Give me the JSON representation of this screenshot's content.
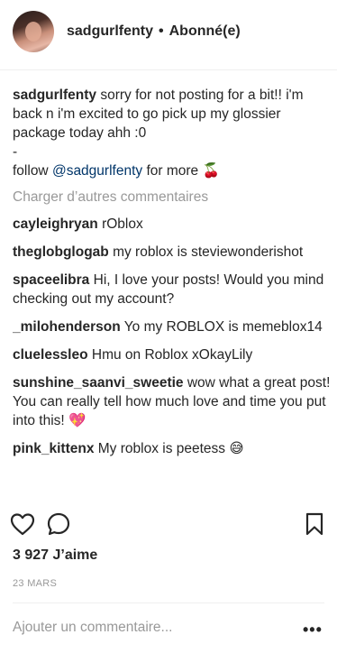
{
  "header": {
    "username": "sadgurlfenty",
    "separator": "•",
    "follow_status": "Abonné(e)"
  },
  "caption": {
    "username": "sadgurlfenty",
    "text": "sorry for not posting for a bit!! i'm back n i'm excited to go pick up my glossier package today ahh :0",
    "dash": "-",
    "follow_prefix": "follow",
    "mention": "@sadgurlfenty",
    "follow_suffix": "for more",
    "emoji": "🍒"
  },
  "load_more": "Charger d’autres commentaires",
  "comments": [
    {
      "username": "cayleighryan",
      "text": "rOblox"
    },
    {
      "username": "theglobglogab",
      "text": "my roblox is steviewonderishot"
    },
    {
      "username": "spaceelibra",
      "text": "Hi, I love your posts! Would you mind checking out my account?"
    },
    {
      "username": "_milohenderson",
      "text": "Yo my ROBLOX is memeblox14"
    },
    {
      "username": "cluelessleo",
      "text": "Hmu on Roblox xOkayLily"
    },
    {
      "username": "sunshine_saanvi_sweetie",
      "text": "wow what a great post! You can really tell how much love and time you put into this! 💖"
    },
    {
      "username": "pink_kittenx",
      "text": "My roblox is peetess 😅"
    }
  ],
  "icons": {
    "like": "heart-icon",
    "comment": "comment-bubble-icon",
    "save": "bookmark-icon",
    "more": "more-options-icon"
  },
  "likes": "3 927 J’aime",
  "date": "23 MARS",
  "add_comment": {
    "placeholder": "Ajouter un commentaire...",
    "more_label": "•••"
  },
  "colors": {
    "text": "#262626",
    "muted": "#999999",
    "mention": "#003569"
  }
}
